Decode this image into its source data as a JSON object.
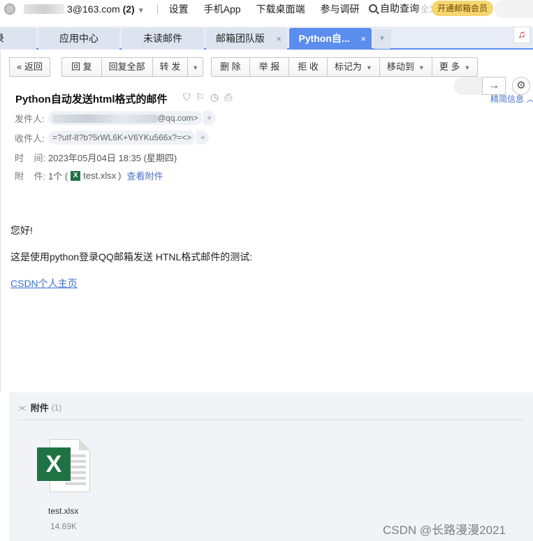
{
  "topbar": {
    "account": "3@163.com",
    "count": "(2)",
    "links": [
      "设置",
      "手机App",
      "下载桌面端",
      "参与调研"
    ],
    "search_label": "自助查询",
    "search_ghost": "全文",
    "vip_label": "开通邮箱会员"
  },
  "tabs": [
    {
      "label": "录"
    },
    {
      "label": "应用中心"
    },
    {
      "label": "未读邮件"
    },
    {
      "label": "邮箱团队版",
      "close": "×"
    },
    {
      "label": "Python自...",
      "close": "×"
    }
  ],
  "toolbar": {
    "back": "返回",
    "reply": "回 复",
    "reply_all": "回复全部",
    "forward": "转 发",
    "delete": "删 除",
    "report": "举 报",
    "reject": "拒 收",
    "mark_as": "标记为",
    "move_to": "移动到",
    "more": "更 多"
  },
  "nav": {
    "brief_info": "精简信息"
  },
  "mail": {
    "subject": "Python自动发送html格式的邮件",
    "from_label": "发件人:",
    "from_value": "@qq.com>",
    "to_label": "收件人:",
    "to_value": "=?utf-8?b?5rWL6K+V6YKu566x?=<>",
    "time_label": "时    间:",
    "time_value": "2023年05月04日 18:35 (星期四)",
    "attach_label": "附    件:",
    "attach_count_prefix": "1个 (",
    "attach_file": "test.xlsx",
    "attach_suffix": ")",
    "view_attachments": "查看附件"
  },
  "body": {
    "greeting": "您好!",
    "paragraph": "这是使用python登录QQ邮箱发送 HTNL格式邮件的测试:",
    "link_text": "CSDN个人主页"
  },
  "attachments": {
    "title": "附件",
    "count": "(1)",
    "files": [
      {
        "name": "test.xlsx",
        "size": "14.69K"
      }
    ]
  },
  "watermark": "CSDN @长路漫漫2021"
}
